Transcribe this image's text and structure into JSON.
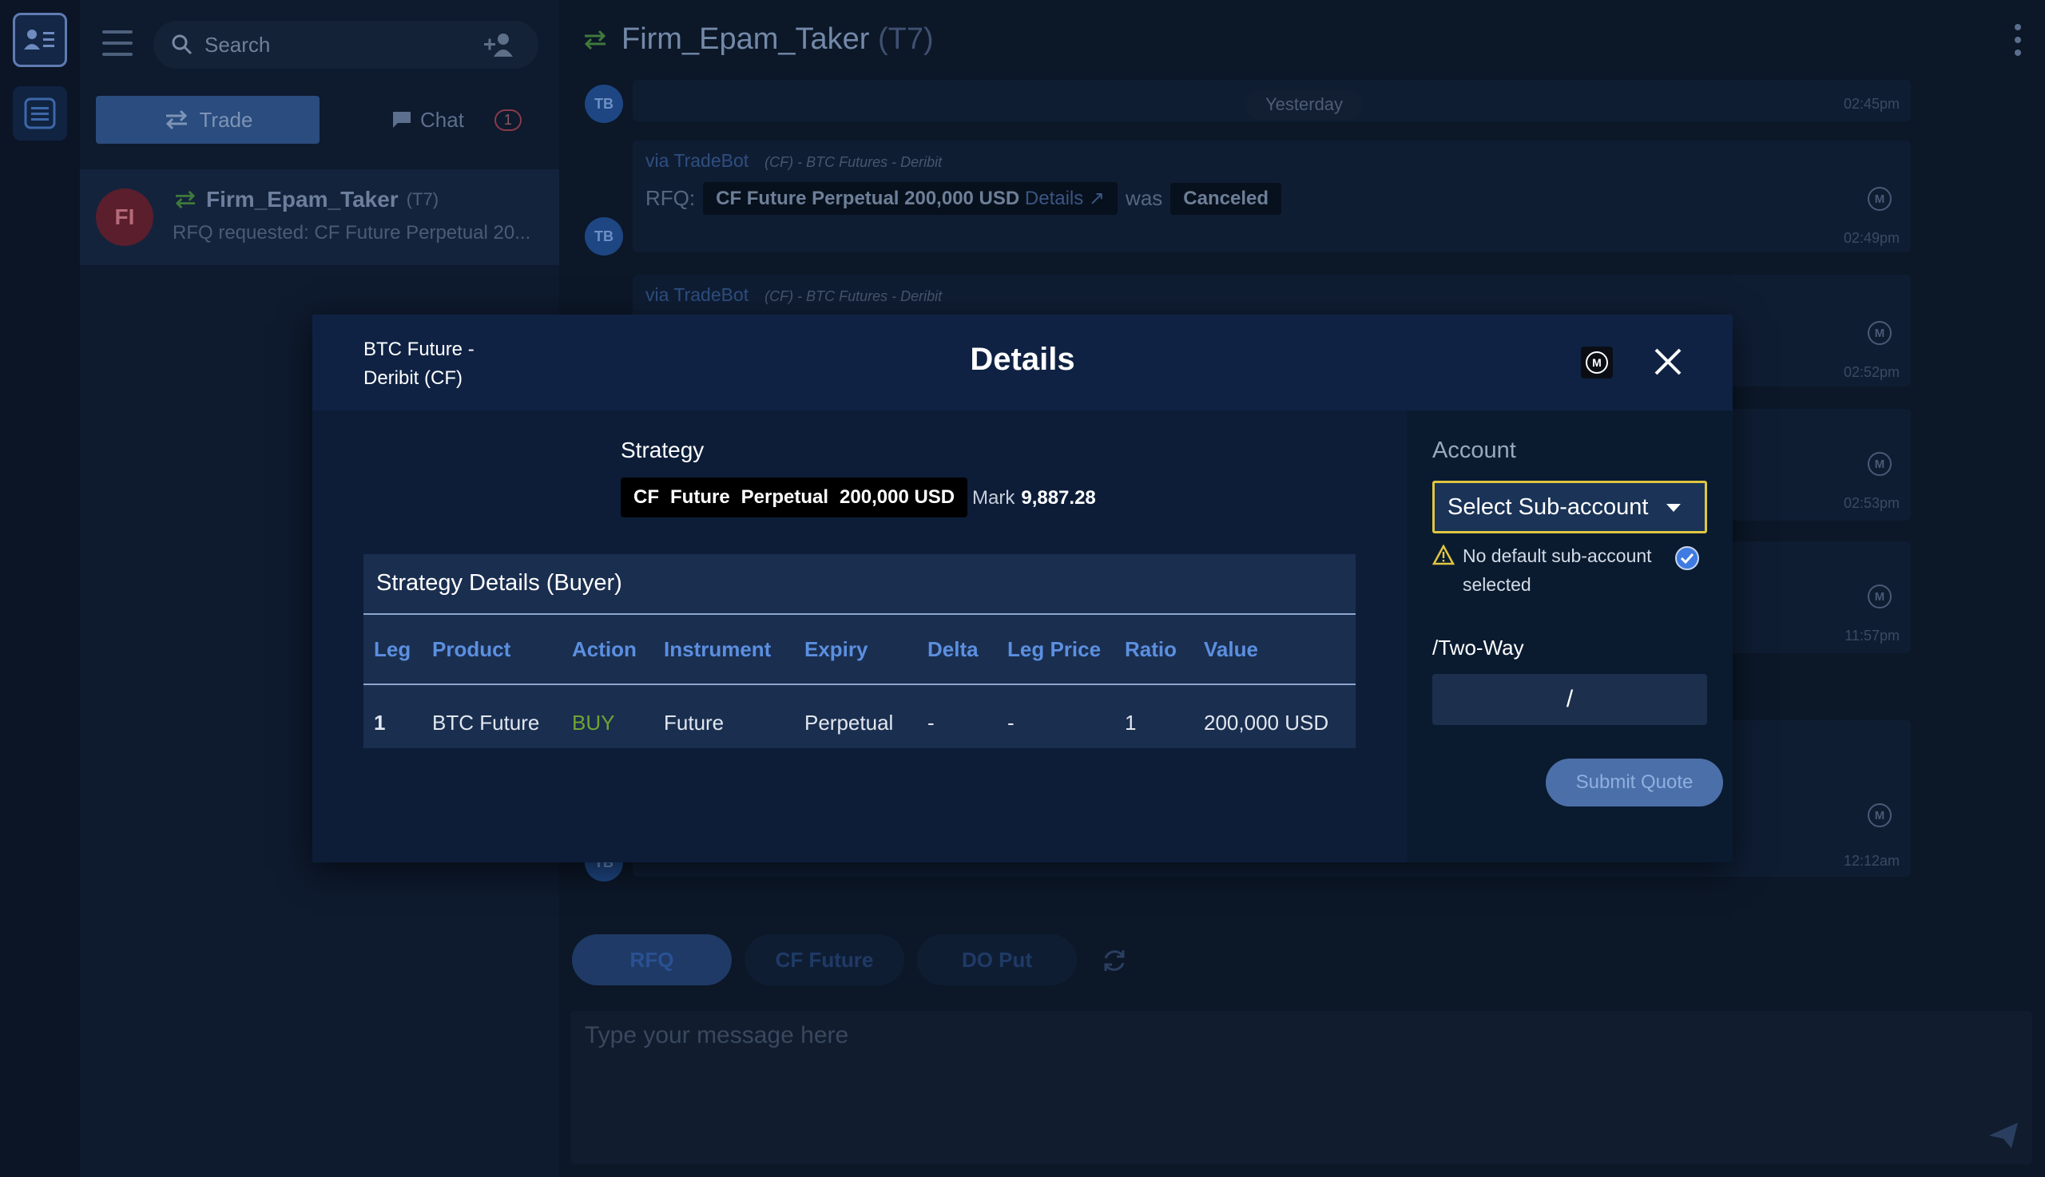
{
  "sidebar": {
    "search_placeholder": "Search",
    "tabs": {
      "trade": "Trade",
      "chat": "Chat",
      "chat_badge": "1"
    },
    "conversation": {
      "initials": "FI",
      "name": "Firm_Epam_Taker",
      "code": "(T7)",
      "preview": "RFQ requested: CF Future Perpetual 20..."
    }
  },
  "chat": {
    "title": "Firm_Epam_Taker",
    "title_code": "(T7)",
    "divider": "Yesterday",
    "avatar_initials": "TB",
    "messages": [
      {
        "time": "02:45pm"
      },
      {
        "via": "via TradeBot",
        "source": "(CF) - BTC Futures - Deribit",
        "rfq_label": "RFQ:",
        "chip": "CF  Future  Perpetual  200,000 USD",
        "details": "Details ↗",
        "was": "was",
        "status": "Canceled",
        "time": "02:49pm"
      },
      {
        "via": "via TradeBot",
        "source": "(CF) - BTC Futures - Deribit",
        "time": "02:52pm"
      },
      {
        "time": "02:53pm"
      },
      {
        "time": "11:57pm"
      },
      {
        "time": "12:12am"
      }
    ],
    "quick_buttons": [
      "RFQ",
      "CF Future",
      "DO Put"
    ],
    "compose_placeholder": "Type your message here"
  },
  "modal": {
    "subtitle_line1": "BTC Future -",
    "subtitle_line2": "Deribit (CF)",
    "title": "Details",
    "mark_icon": "M",
    "strategy_label": "Strategy",
    "strategy_chip": [
      "CF",
      "Future",
      "Perpetual",
      "200,000 USD"
    ],
    "mark_label": "Mark",
    "mark_value": "9,887.28",
    "table_title": "Strategy Details (Buyer)",
    "columns": [
      "Leg",
      "Product",
      "Action",
      "Instrument",
      "Expiry",
      "Delta",
      "Leg Price",
      "Ratio",
      "Value"
    ],
    "rows": [
      [
        "1",
        "BTC Future",
        "BUY",
        "Future",
        "Perpetual",
        "-",
        "-",
        "1",
        "200,000 USD"
      ]
    ],
    "account_label": "Account",
    "account_select": "Select Sub-account",
    "warning": "No default sub-account selected",
    "two_way_label": "/Two-Way",
    "two_way_value": "/",
    "submit": "Submit Quote"
  },
  "colors": {
    "accent": "#5b8fe0",
    "buy": "#6fa534",
    "select_border": "#e0c641",
    "modal_bg": "#0f2243"
  }
}
